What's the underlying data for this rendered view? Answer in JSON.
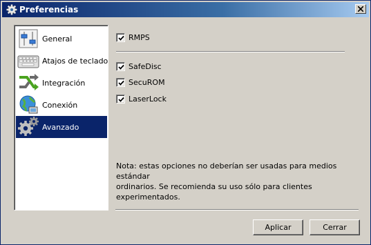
{
  "window": {
    "title": "Preferencias"
  },
  "sidebar": {
    "items": [
      {
        "label": "General",
        "icon": "sliders-icon"
      },
      {
        "label": "Atajos de teclado",
        "icon": "keyboard-icon"
      },
      {
        "label": "Integración",
        "icon": "integration-arrows-icon"
      },
      {
        "label": "Conexión",
        "icon": "globe-network-icon"
      },
      {
        "label": "Avanzado",
        "icon": "gears-icon",
        "selected": true
      }
    ]
  },
  "options": {
    "rmps": {
      "label": "RMPS",
      "checked": true
    },
    "safedisc": {
      "label": "SafeDisc",
      "checked": true
    },
    "securom": {
      "label": "SecuROM",
      "checked": true
    },
    "laserlock": {
      "label": "LaserLock",
      "checked": true
    }
  },
  "note": {
    "line1": "Nota: estas opciones no deberían ser usadas para medios estándar",
    "line2": "ordinarios. Se recomienda su uso sólo para clientes experimentados."
  },
  "buttons": {
    "apply": "Aplicar",
    "close": "Cerrar"
  },
  "colors": {
    "selection": "#0a246a",
    "face": "#d4d0c8"
  }
}
